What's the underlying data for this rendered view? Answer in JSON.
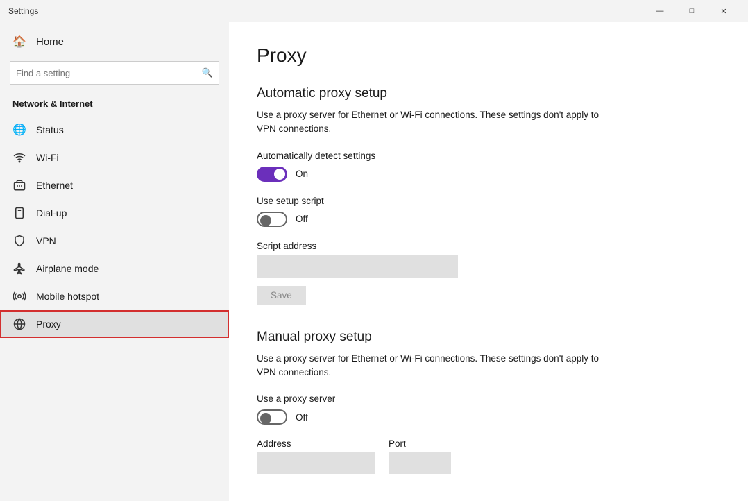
{
  "titlebar": {
    "title": "Settings",
    "minimize": "—",
    "maximize": "□",
    "close": "✕"
  },
  "sidebar": {
    "home_label": "Home",
    "search_placeholder": "Find a setting",
    "section_title": "Network & Internet",
    "items": [
      {
        "id": "status",
        "label": "Status",
        "icon": "🌐"
      },
      {
        "id": "wifi",
        "label": "Wi-Fi",
        "icon": "📶"
      },
      {
        "id": "ethernet",
        "label": "Ethernet",
        "icon": "🖥"
      },
      {
        "id": "dialup",
        "label": "Dial-up",
        "icon": "📞"
      },
      {
        "id": "vpn",
        "label": "VPN",
        "icon": "🔗"
      },
      {
        "id": "airplane",
        "label": "Airplane mode",
        "icon": "✈"
      },
      {
        "id": "hotspot",
        "label": "Mobile hotspot",
        "icon": "📡"
      },
      {
        "id": "proxy",
        "label": "Proxy",
        "icon": "🌐",
        "active": true
      }
    ]
  },
  "content": {
    "page_title": "Proxy",
    "auto_section": {
      "title": "Automatic proxy setup",
      "desc": "Use a proxy server for Ethernet or Wi-Fi connections. These settings don't apply to VPN connections.",
      "auto_detect_label": "Automatically detect settings",
      "auto_detect_state": "On",
      "auto_detect_on": true,
      "setup_script_label": "Use setup script",
      "setup_script_state": "Off",
      "setup_script_on": false,
      "script_address_label": "Script address",
      "save_label": "Save"
    },
    "manual_section": {
      "title": "Manual proxy setup",
      "desc": "Use a proxy server for Ethernet or Wi-Fi connections. These settings don't apply to VPN connections.",
      "use_proxy_label": "Use a proxy server",
      "use_proxy_state": "Off",
      "use_proxy_on": false,
      "address_label": "Address",
      "port_label": "Port"
    }
  }
}
